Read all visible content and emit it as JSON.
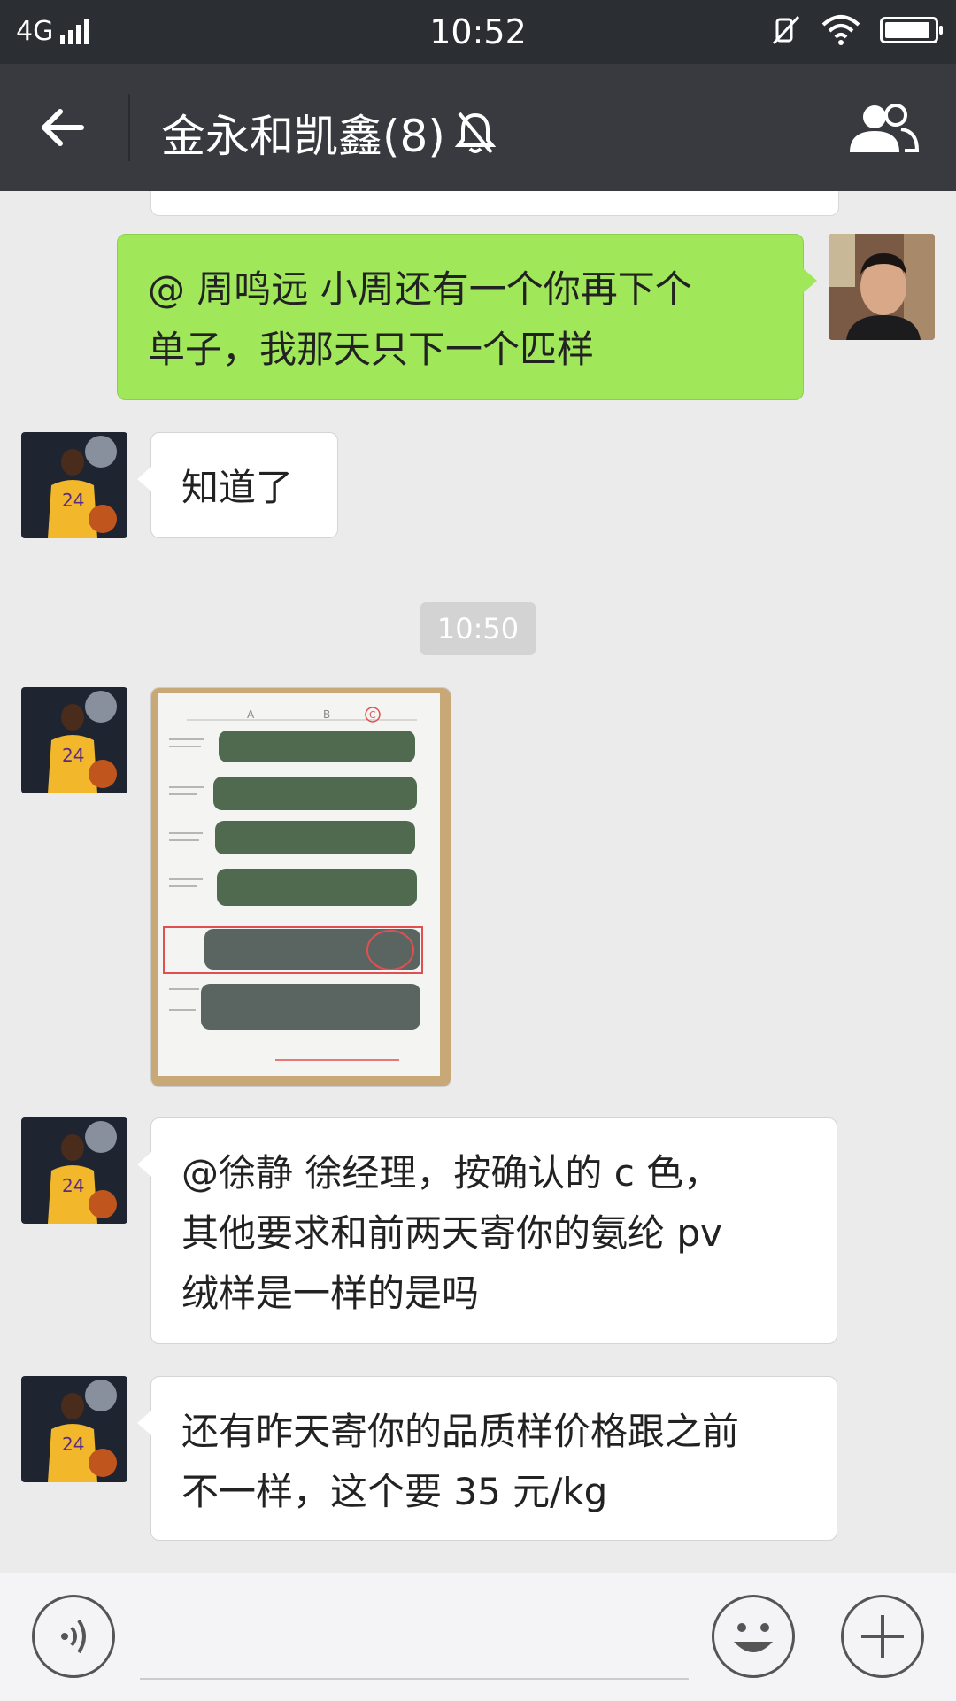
{
  "status_bar": {
    "network": "4G",
    "time": "10:52"
  },
  "nav": {
    "title": "金永和凯鑫(8)"
  },
  "chat": {
    "messages": [
      {
        "side": "right",
        "text_line1": "@ 周鸣远  小周还有一个你再下个",
        "text_line2": "单子，我那天只下一个匹样"
      },
      {
        "side": "left",
        "text": "知道了"
      },
      {
        "type": "time",
        "text": "10:50"
      },
      {
        "side": "left",
        "type": "image"
      },
      {
        "side": "left",
        "text_line1": "@徐静  徐经理，按确认的 c 色，",
        "text_line2": "其他要求和前两天寄你的氨纶 pv",
        "text_line3": "绒样是一样的是吗"
      },
      {
        "side": "left",
        "text_line1": "还有昨天寄你的品质样价格跟之前",
        "text_line2": "不一样，这个要 35 元/kg"
      }
    ]
  },
  "photo": {
    "labels": [
      "A",
      "B",
      "C"
    ]
  },
  "colors": {
    "nav_bg": "#393a3f",
    "status_bg": "#2b2f33",
    "chat_bg": "#ebebeb",
    "bubble_green": "#a0e75a"
  }
}
